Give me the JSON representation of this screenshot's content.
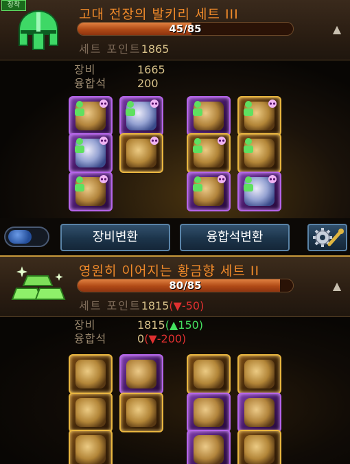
{
  "sets": [
    {
      "equipped_tag": "장착",
      "title": "고대 전장의 발키리 세트 III",
      "progress_text": "45/85",
      "progress_fraction": 0.53,
      "setpoint_label": "세트 포인트",
      "setpoint_value": "1865",
      "stats": [
        {
          "label": "장비",
          "value": "1665"
        },
        {
          "label": "융합석",
          "value": "200"
        }
      ]
    },
    {
      "title": "영원히 이어지는 황금향 세트 II",
      "progress_text": "80/85",
      "progress_fraction": 0.94,
      "setpoint_label": "세트 포인트",
      "setpoint_value": "1815",
      "setpoint_delta": "(▼-50)",
      "stats": [
        {
          "label": "장비",
          "value": "1815",
          "delta": "(▲150)",
          "delta_color": "green"
        },
        {
          "label": "융합석",
          "value": "0",
          "delta": "(▼-200)",
          "delta_color": "red"
        }
      ]
    }
  ],
  "toolbar": {
    "equip_convert": "장비변환",
    "fusion_convert": "융합석변환"
  },
  "icons": {
    "set1_emblem": "green-helmet-icon",
    "set2_emblem": "gold-bars-icon",
    "collapse": "triangle-up-icon",
    "settings": "gear-wrench-icon"
  },
  "colors": {
    "title": "#f08a2a",
    "progress": "#c0561e",
    "purple_border": "#b564ea",
    "gold_border": "#e9b640",
    "button": "#1c344a"
  }
}
